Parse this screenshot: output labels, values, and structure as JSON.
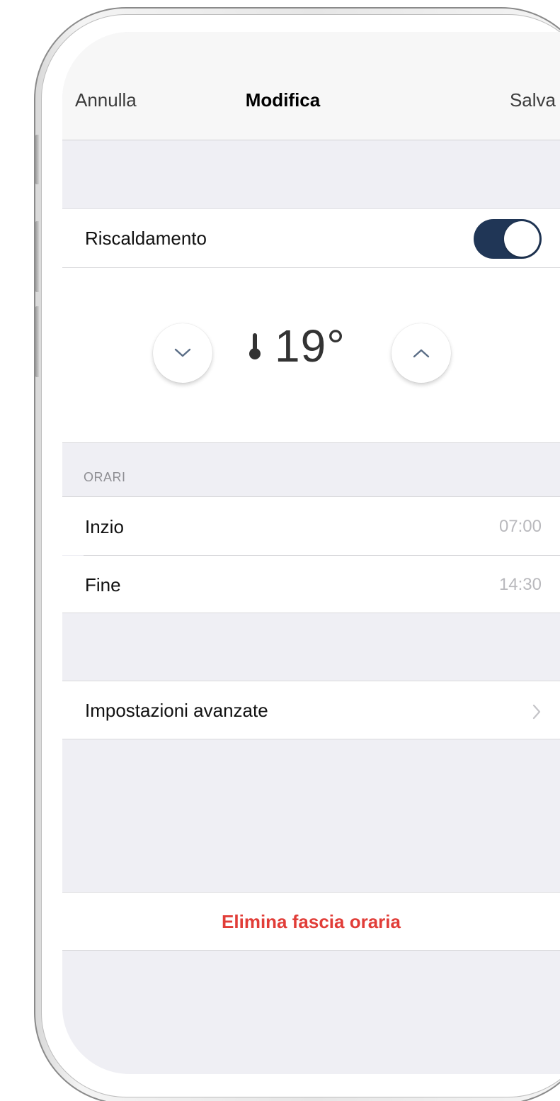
{
  "navbar": {
    "cancel_label": "Annulla",
    "title": "Modifica",
    "save_label": "Salva"
  },
  "heating": {
    "label": "Riscaldamento",
    "toggle_on": true,
    "toggle_color": "#203656"
  },
  "temperature": {
    "value": "19°",
    "decrease_icon": "chevron-down-icon",
    "increase_icon": "chevron-up-icon",
    "thermometer_icon": "thermometer-icon"
  },
  "schedule": {
    "section_header": "ORARI",
    "start": {
      "label": "Inzio",
      "value": "07:00"
    },
    "end": {
      "label": "Fine",
      "value": "14:30"
    }
  },
  "advanced": {
    "label": "Impostazioni avanzate",
    "chevron_icon": "chevron-right-icon"
  },
  "delete": {
    "label": "Elimina fascia oraria",
    "color": "#e13d38"
  }
}
